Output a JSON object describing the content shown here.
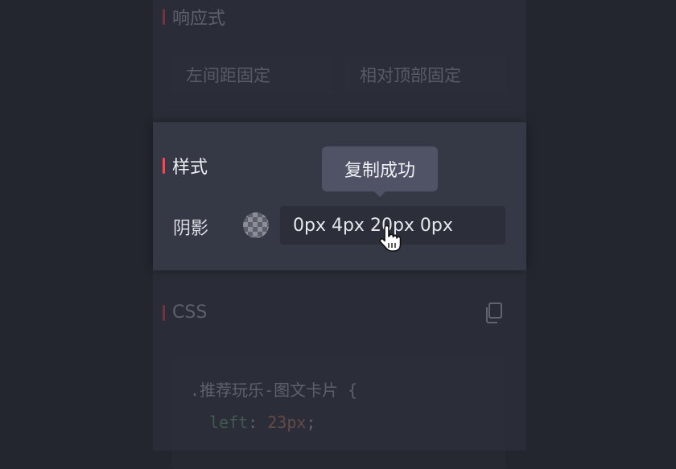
{
  "responsive": {
    "title": "响应式",
    "options": [
      "左间距固定",
      "相对顶部固定"
    ]
  },
  "style": {
    "title": "样式",
    "shadow_label": "阴影",
    "shadow_value": "0px 4px 20px 0px"
  },
  "tooltip": {
    "text": "复制成功"
  },
  "css": {
    "title": "CSS",
    "code": {
      "selector": ".推荐玩乐-图文卡片 {",
      "property": "left",
      "colon": ":",
      "value": "23px",
      "semicolon": ";"
    }
  },
  "colors": {
    "accent": "#e0505e",
    "code_property": "#6fb37f",
    "code_value": "#d98a64"
  },
  "icons": {
    "copy": "copy-icon",
    "swatch": "checker-swatch",
    "cursor": "hand-pointer"
  }
}
